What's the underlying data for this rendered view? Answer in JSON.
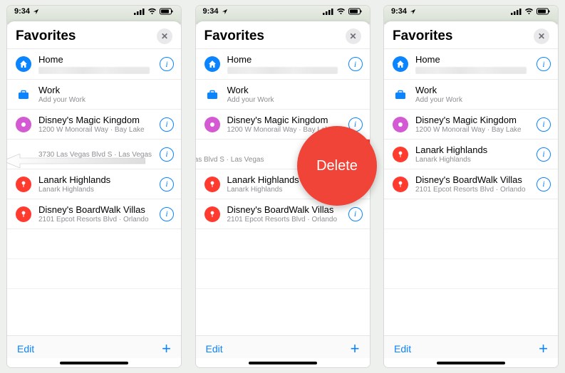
{
  "status": {
    "time": "9:34",
    "location_arrow": true
  },
  "sheet": {
    "title": "Favorites"
  },
  "rows": {
    "home": {
      "primary": "Home"
    },
    "work": {
      "primary": "Work",
      "secondary": "Add your Work"
    },
    "disney": {
      "primary": "Disney's Magic Kingdom",
      "secondary": "1200 W Monorail Way · Bay Lake"
    },
    "vegas": {
      "primary": "",
      "secondary": "3730 Las Vegas Blvd S · Las Vegas"
    },
    "vegas_shifted_secondary": "gas Vegas Blvd S · Las Vegas",
    "lanark": {
      "primary": "Lanark Highlands",
      "secondary": "Lanark Highlands"
    },
    "boardwalk": {
      "primary": "Disney's BoardWalk Villas",
      "secondary": "2101 Epcot Resorts Blvd · Orlando"
    }
  },
  "toolbar": {
    "edit": "Edit",
    "add": "+"
  },
  "delete_bubble": "Delete",
  "info_glyph": "i",
  "close_glyph": "✕"
}
